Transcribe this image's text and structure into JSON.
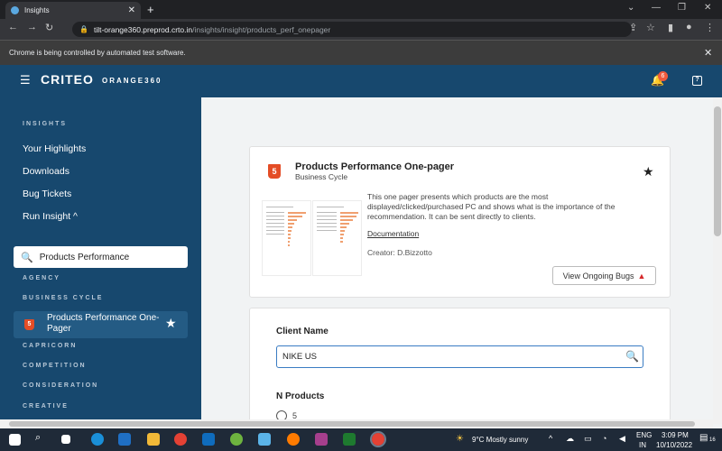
{
  "browser": {
    "tab_title": "Insights",
    "tab_close": "✕",
    "new_tab": "+",
    "url_host": "tilt-orange360.preprod.crto.in",
    "url_path": "/insights/insight/products_perf_onepager",
    "infobar_text": "Chrome is being controlled by automated test software.",
    "window_controls": [
      "⌄",
      "—",
      "❐",
      "✕"
    ]
  },
  "header": {
    "logo": "CRITEO",
    "product": "ORANGE360",
    "notification_count": "6",
    "help_label": "?"
  },
  "sidebar": {
    "section_title": "INSIGHTS",
    "items": [
      {
        "label": "Your Highlights"
      },
      {
        "label": "Downloads"
      },
      {
        "label": "Bug Tickets"
      },
      {
        "label": "Run Insight ^"
      }
    ],
    "search_value": "Products Performance",
    "categories": [
      "AGENCY",
      "BUSINESS CYCLE",
      "CAPRICORN",
      "COMPETITION",
      "CONSIDERATION",
      "CREATIVE"
    ],
    "active_item": "Products Performance One-Pager",
    "html_badge": "5"
  },
  "insight_card": {
    "title": "Products Performance One-pager",
    "category": "Business Cycle",
    "description": "This one pager presents which products are the most displayed/clicked/purchased PC and shows what is the importance of the recommendation. It can be sent directly to clients.",
    "documentation_link": "Documentation",
    "creator": "Creator: D.Bizzotto",
    "bugs_button": "View Ongoing Bugs",
    "html_badge": "5"
  },
  "form": {
    "client_label": "Client Name",
    "client_value": "NIKE US",
    "n_products_label": "N Products",
    "n_products_options": [
      "5"
    ]
  },
  "taskbar": {
    "weather": "9°C  Mostly sunny",
    "lang_top": "ENG",
    "lang_bottom": "IN",
    "time": "3:09 PM",
    "date": "10/10/2022",
    "notif": "16"
  },
  "colors": {
    "header_bg": "#17486e",
    "accent_orange": "#e44d26",
    "badge": "#f05a3c",
    "input_focus": "#3a7cc3"
  }
}
